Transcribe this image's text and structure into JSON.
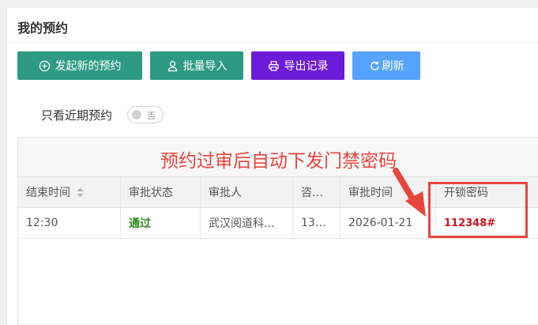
{
  "panel": {
    "title": "我的预约"
  },
  "toolbar": {
    "new_label": "发起新的预约",
    "import_label": "批量导入",
    "export_label": "导出记录",
    "refresh_label": "刷新"
  },
  "filter": {
    "label": "只看近期预约",
    "switch_text": "否",
    "checked": false
  },
  "annotation": "预约过审后自动下发门禁密码",
  "table": {
    "columns": [
      "结束时间",
      "审批状态",
      "审批人",
      "咨…",
      "审批时间",
      "开锁密码"
    ],
    "rows": [
      [
        "12:30",
        "通过",
        "武汉阅道科…",
        "13…",
        "2026-01-21",
        "112348#"
      ]
    ]
  },
  "colors": {
    "primary": "#2e9a83",
    "export": "#6c1bd9",
    "refresh": "#56a4ff",
    "annotation": "#e8453c",
    "pass": "#2f8a1e",
    "code": "#d4101c"
  },
  "icons": [
    "plus-circle-icon",
    "user-icon",
    "printer-icon",
    "refresh-icon",
    "sort-icon"
  ]
}
